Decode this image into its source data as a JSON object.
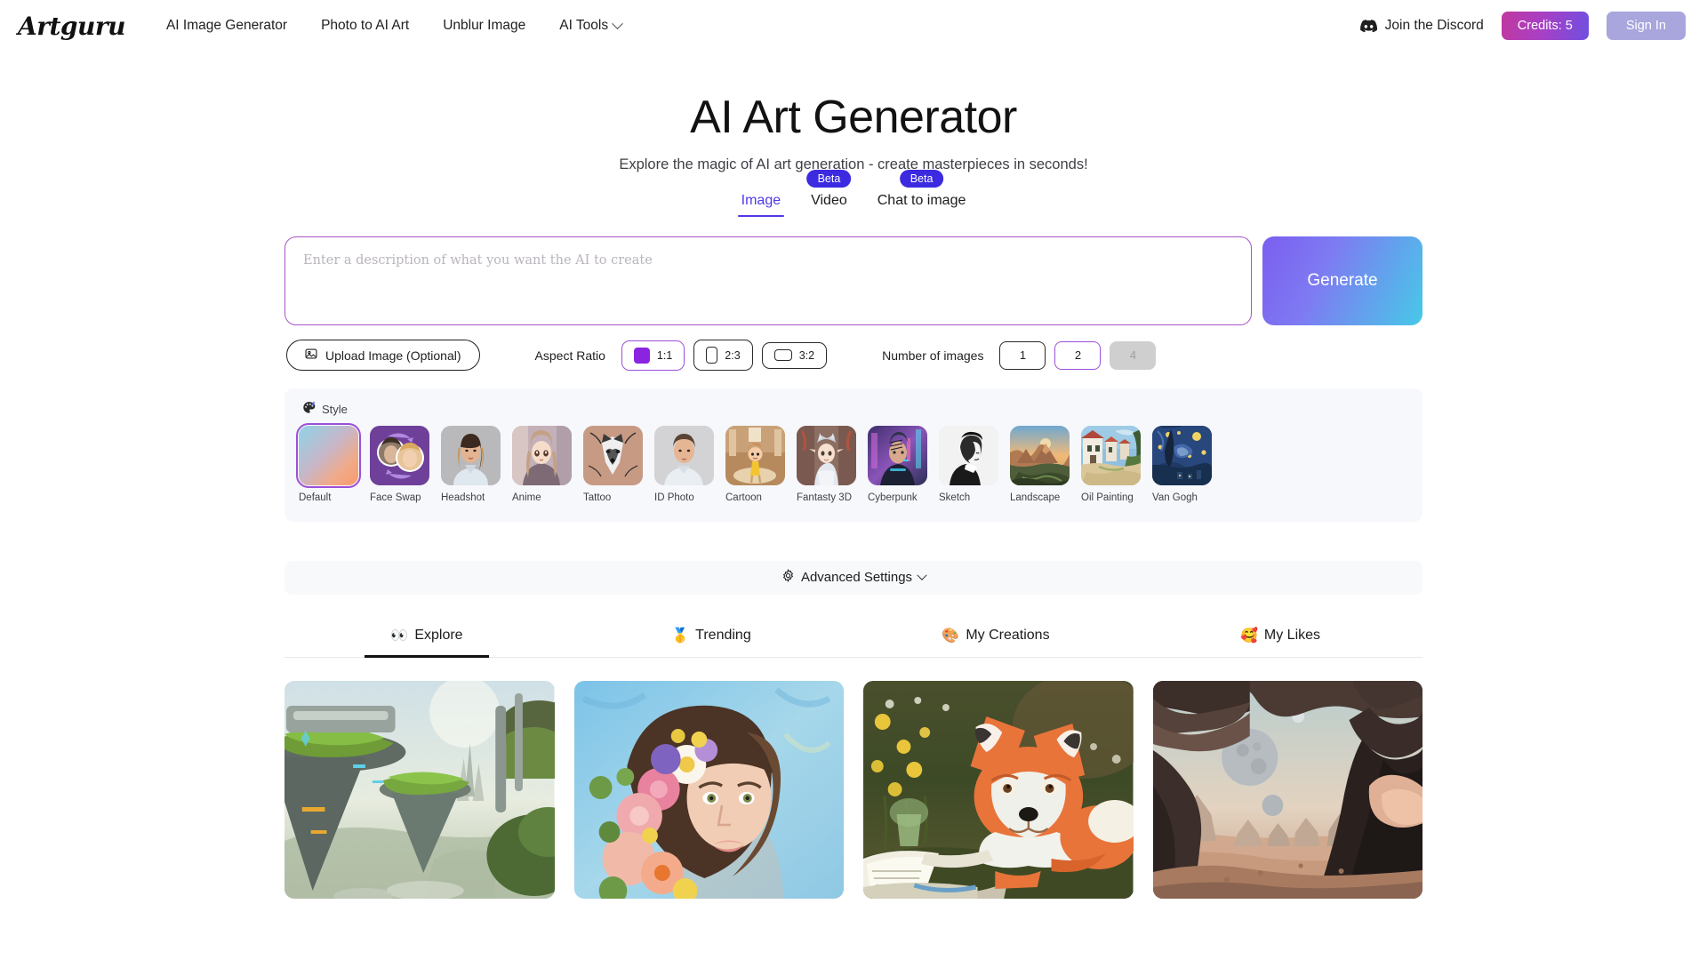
{
  "header": {
    "logo": "Artguru",
    "nav": [
      {
        "label": "AI Image Generator",
        "icon": null
      },
      {
        "label": "Photo to AI Art",
        "icon": null
      },
      {
        "label": "Unblur Image",
        "icon": null
      },
      {
        "label": "AI Tools",
        "icon": "chevron-down-icon"
      }
    ],
    "discord_label": "Join the Discord",
    "discord_icon": "discord-icon",
    "credits_label": "Credits: 5",
    "signin_label": "Sign In",
    "credits_gradient_from": "#c0399f",
    "credits_gradient_to": "#6f4fe0",
    "signin_color": "#a9a5dd"
  },
  "hero": {
    "title": "AI Art Generator",
    "subtitle": "Explore the magic of AI art generation - create masterpieces in seconds!"
  },
  "mode_tabs": [
    {
      "label": "Image",
      "badge": null,
      "active": true
    },
    {
      "label": "Video",
      "badge": "Beta",
      "active": false
    },
    {
      "label": "Chat to image",
      "badge": "Beta",
      "active": false
    }
  ],
  "accent_color": "#4f39e8",
  "prompt": {
    "value": "",
    "placeholder": "Enter a description of what you want the AI to create",
    "border_color": "#a855c9"
  },
  "generate": {
    "label": "Generate",
    "gradient_from": "#7b5ef0",
    "gradient_to": "#47c9e8"
  },
  "options": {
    "upload_label": "Upload Image (Optional)",
    "upload_icon": "image-icon",
    "aspect_ratio_label": "Aspect Ratio",
    "aspect_ratios": [
      {
        "label": "1:1",
        "selected": true
      },
      {
        "label": "2:3",
        "selected": false
      },
      {
        "label": "3:2",
        "selected": false
      }
    ],
    "number_label": "Number of images",
    "numbers": [
      {
        "label": "1",
        "selected": false,
        "disabled": false
      },
      {
        "label": "2",
        "selected": true,
        "disabled": false
      },
      {
        "label": "4",
        "selected": false,
        "disabled": true
      }
    ]
  },
  "style": {
    "heading": "Style",
    "heading_icon": "palette-icon",
    "items": [
      {
        "label": "Default",
        "selected": true
      },
      {
        "label": "Face Swap",
        "selected": false
      },
      {
        "label": "Headshot",
        "selected": false
      },
      {
        "label": "Anime",
        "selected": false
      },
      {
        "label": "Tattoo",
        "selected": false
      },
      {
        "label": "ID Photo",
        "selected": false
      },
      {
        "label": "Cartoon",
        "selected": false
      },
      {
        "label": "Fantasty 3D",
        "selected": false
      },
      {
        "label": "Cyberpunk",
        "selected": false
      },
      {
        "label": "Sketch",
        "selected": false
      },
      {
        "label": "Landscape",
        "selected": false
      },
      {
        "label": "Oil Painting",
        "selected": false
      },
      {
        "label": "Van Gogh",
        "selected": false
      }
    ]
  },
  "advanced": {
    "label": "Advanced Settings",
    "icon": "gear-icon",
    "chevron": "chevron-down-icon"
  },
  "gallery_tabs": [
    {
      "emoji": "👀",
      "label": "Explore",
      "active": true
    },
    {
      "emoji": "🥇",
      "label": "Trending",
      "active": false
    },
    {
      "emoji": "🎨",
      "label": "My Creations",
      "active": false
    },
    {
      "emoji": "🥰",
      "label": "My Likes",
      "active": false
    }
  ],
  "gallery": [
    {
      "alt": "Futuristic green floating city towers"
    },
    {
      "alt": "Portrait of woman with flower crown"
    },
    {
      "alt": "Fox reading a book in a meadow"
    },
    {
      "alt": "Alien desert planet seen from cave with moons"
    }
  ]
}
